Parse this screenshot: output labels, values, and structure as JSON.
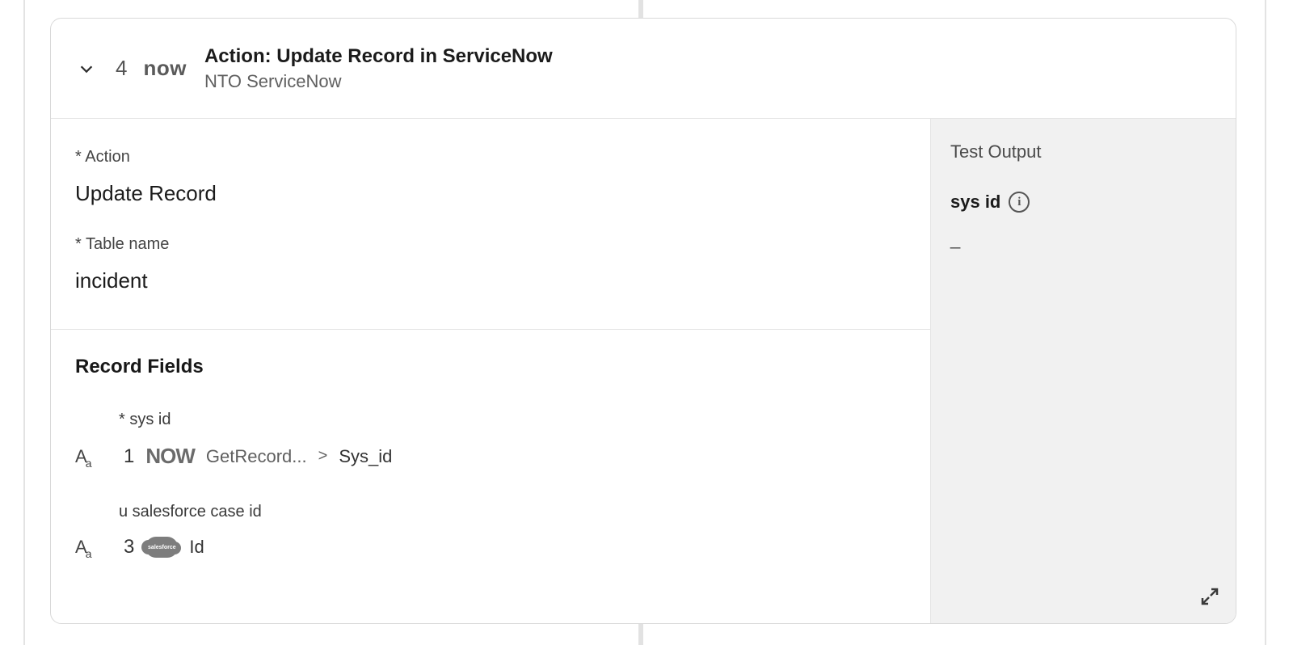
{
  "header": {
    "step_number": "4",
    "logo_text": "now",
    "title": "Action: Update Record in ServiceNow",
    "subtitle": "NTO ServiceNow"
  },
  "config": {
    "action_label": "* Action",
    "action_value": "Update Record",
    "table_label": "* Table name",
    "table_value": "incident"
  },
  "record_fields": {
    "heading": "Record Fields",
    "f1": {
      "label": "* sys id",
      "type_glyph_big": "A",
      "type_glyph_small": "a",
      "pill_step": "1",
      "pill_logo": "NOW",
      "pill_text": "GetRecord...",
      "crumb_sep": ">",
      "crumb_value": "Sys_id"
    },
    "f2": {
      "label": "u salesforce case id",
      "type_glyph_big": "A",
      "type_glyph_small": "a",
      "pill_step": "3",
      "cloud_text": "salesforce",
      "pill_value": "Id"
    }
  },
  "test_output": {
    "heading": "Test Output",
    "field_label": "sys id",
    "value": "_"
  }
}
